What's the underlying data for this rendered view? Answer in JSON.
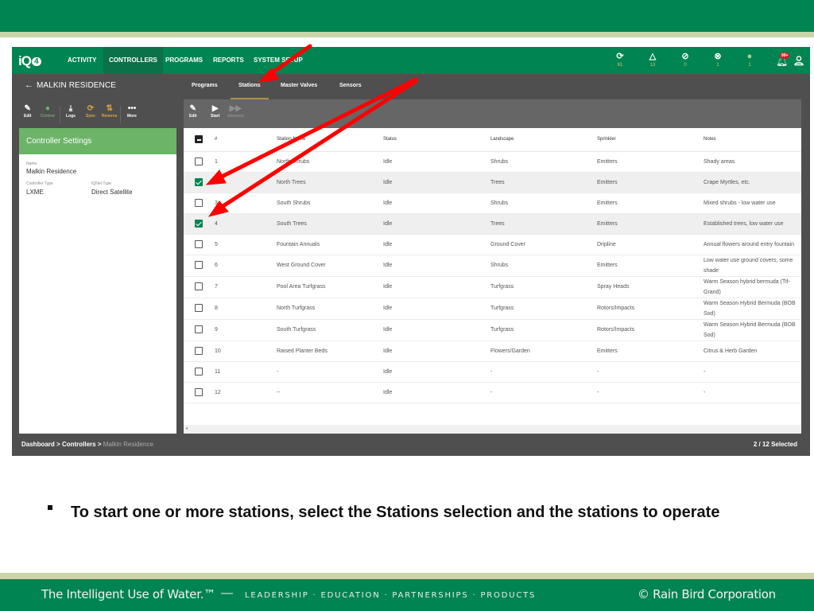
{
  "slide": {
    "bullet_text": "To start one or more stations, select the Stations selection and the stations to operate",
    "footer": {
      "tagline": "The Intelligent Use of Water.™",
      "dash": "—",
      "links": "LEADERSHIP · EDUCATION · PARTNERSHIPS · PRODUCTS",
      "copyright": "© Rain Bird Corporation"
    },
    "colors": {
      "brand_green": "#008451",
      "band": "#c8d5a8",
      "arrow": "#ff0000"
    }
  },
  "app": {
    "logo": {
      "text": "iQ",
      "badge": "4"
    },
    "nav": [
      {
        "label": "ACTIVITY",
        "active": false
      },
      {
        "label": "CONTROLLERS",
        "active": true
      },
      {
        "label": "PROGRAMS",
        "active": false
      },
      {
        "label": "REPORTS",
        "active": false
      },
      {
        "label": "SYSTEM SETUP",
        "active": false
      }
    ],
    "status_icons": [
      {
        "icon": "sync-icon",
        "glyph": "⟳",
        "count": "61"
      },
      {
        "icon": "warning-triangle-icon",
        "glyph": "△",
        "count": "13"
      },
      {
        "icon": "offline-icon",
        "glyph": "⊘",
        "count": "0"
      },
      {
        "icon": "error-x-icon",
        "glyph": "⊗",
        "count": "1"
      },
      {
        "icon": "green-dot-icon",
        "glyph": "●",
        "count": "1"
      }
    ],
    "notifications_badge": "99+",
    "controller": {
      "back_glyph": "←",
      "name": "MALKIN RESIDENCE"
    },
    "tabs": [
      {
        "label": "Programs",
        "active": false
      },
      {
        "label": "Stations",
        "active": true
      },
      {
        "label": "Master Valves",
        "active": false
      },
      {
        "label": "Sensors",
        "active": false
      }
    ],
    "left_toolbar": [
      {
        "label": "Edit",
        "glyph": "✎"
      },
      {
        "label": "Control",
        "glyph": "●"
      },
      {
        "label": "Logs",
        "glyph": "⤓"
      },
      {
        "label": "Sync",
        "glyph": "⟳"
      },
      {
        "label": "Reverse",
        "glyph": "⇅"
      },
      {
        "label": "More",
        "glyph": "•••"
      }
    ],
    "settings": {
      "title": "Controller Settings",
      "name_label": "Name",
      "name_value": "Malkin Residence",
      "type_label": "Controller Type",
      "type_value": "LXME",
      "iqnet_label": "IQNet Type",
      "iqnet_value": "Direct Satellite"
    },
    "main_toolbar": [
      {
        "label": "Edit",
        "glyph": "✎",
        "enabled": true
      },
      {
        "label": "Start",
        "glyph": "▶",
        "enabled": true
      },
      {
        "label": "Advance",
        "glyph": "▶▶",
        "enabled": false
      }
    ],
    "table": {
      "headers": [
        "#",
        "Station Name",
        "Status",
        "Landscape",
        "Sprinkler",
        "Notes"
      ],
      "rows": [
        {
          "num": "1",
          "name": "North Shrubs",
          "status": "Idle",
          "landscape": "Shrubs",
          "sprinkler": "Emitters",
          "notes": "Shady areas",
          "checked": false
        },
        {
          "num": "2",
          "name": "North Trees",
          "status": "Idle",
          "landscape": "Trees",
          "sprinkler": "Emitters",
          "notes": "Crape Myrtles, etc.",
          "checked": true
        },
        {
          "num": "3",
          "name": "South Shrubs",
          "status": "Idle",
          "landscape": "Shrubs",
          "sprinkler": "Emitters",
          "notes": "Mixed shrubs - low water use",
          "checked": false
        },
        {
          "num": "4",
          "name": "South Trees",
          "status": "Idle",
          "landscape": "Trees",
          "sprinkler": "Emitters",
          "notes": "Established trees, low water use",
          "checked": true
        },
        {
          "num": "5",
          "name": "Fountain Annuals",
          "status": "Idle",
          "landscape": "Ground Cover",
          "sprinkler": "Dripline",
          "notes": "Annual flowers around entry fountain",
          "checked": false
        },
        {
          "num": "6",
          "name": "West Ground Cover",
          "status": "Idle",
          "landscape": "Shrubs",
          "sprinkler": "Emitters",
          "notes": "Low water use ground covers, some shade",
          "checked": false
        },
        {
          "num": "7",
          "name": "Pool Area Turfgrass",
          "status": "Idle",
          "landscape": "Turfgrass",
          "sprinkler": "Spray Heads",
          "notes": "Warm Season hybrid bermuda (Tif-Grand)",
          "checked": false
        },
        {
          "num": "8",
          "name": "North Turfgrass",
          "status": "Idle",
          "landscape": "Turfgrass",
          "sprinkler": "Rotors/Impacts",
          "notes": "Warm Season Hybrid Bermuda (BOB Sod)",
          "checked": false
        },
        {
          "num": "9",
          "name": "South Turfgrass",
          "status": "Idle",
          "landscape": "Turfgrass",
          "sprinkler": "Rotors/Impacts",
          "notes": "Warm Season Hybrid Bermuda (BOB Sod)",
          "checked": false
        },
        {
          "num": "10",
          "name": "Raised Planter Beds",
          "status": "Idle",
          "landscape": "Flowers/Garden",
          "sprinkler": "Emitters",
          "notes": "Citrus & Herb Garden",
          "checked": false
        },
        {
          "num": "11",
          "name": "-",
          "status": "Idle",
          "landscape": "-",
          "sprinkler": "-",
          "notes": "-",
          "checked": false
        },
        {
          "num": "12",
          "name": "--",
          "status": "Idle",
          "landscape": "-",
          "sprinkler": "-",
          "notes": "-",
          "checked": false
        }
      ]
    },
    "breadcrumb": {
      "items": [
        "Dashboard",
        "Controllers"
      ],
      "separator": ">",
      "current": "Malkin Residence"
    },
    "selection_status": "2 / 12 Selected"
  }
}
